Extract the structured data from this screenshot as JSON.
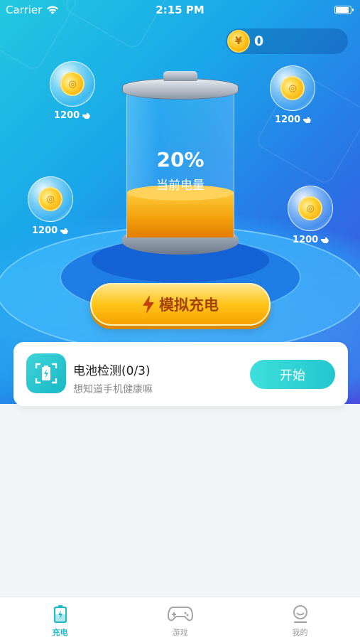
{
  "status_bar": {
    "carrier": "Carrier",
    "time": "2:15 PM"
  },
  "coins": {
    "symbol": "¥",
    "count": "0"
  },
  "bubbles": [
    {
      "label": "1200"
    },
    {
      "label": "1200"
    },
    {
      "label": "1200"
    },
    {
      "label": "1200"
    }
  ],
  "battery": {
    "percent": "20%",
    "label": "当前电量",
    "level": 0.2
  },
  "simulate_button": {
    "label": "模拟充电"
  },
  "task_card": {
    "title": "电池检测(0/3)",
    "subtitle": "想知道手机健康嘛",
    "button": "开始"
  },
  "tabbar": {
    "tabs": [
      {
        "label": "充电",
        "icon": "battery-charge-icon",
        "active": true
      },
      {
        "label": "游戏",
        "icon": "gamepad-icon",
        "active": false
      },
      {
        "label": "我的",
        "icon": "profile-icon",
        "active": false
      }
    ]
  },
  "colors": {
    "accent": "#23b9c8",
    "gold": "#ffc41a",
    "button_text": "#a3420a"
  }
}
